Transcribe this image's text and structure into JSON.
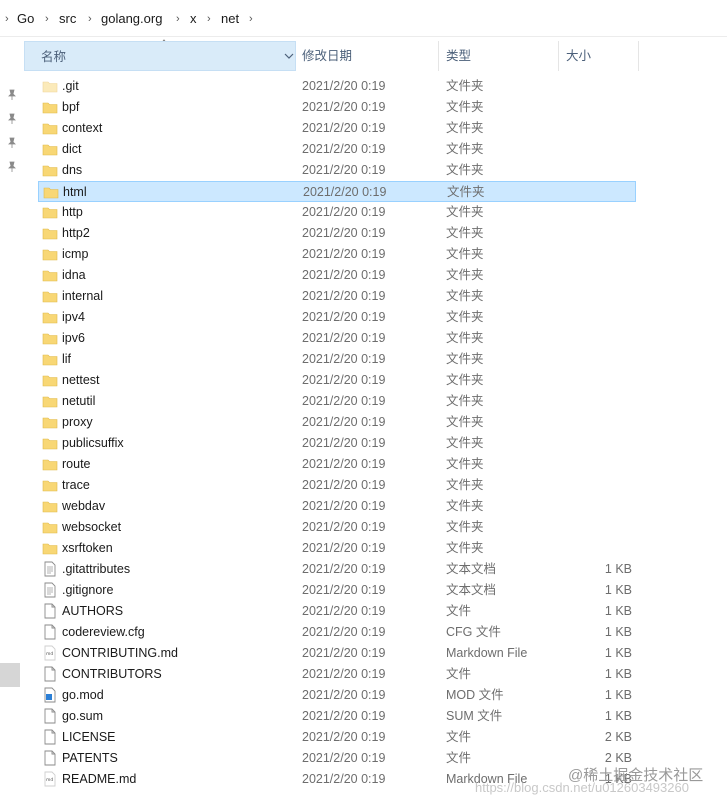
{
  "breadcrumb": [
    "Go",
    "src",
    "golang.org",
    "x",
    "net"
  ],
  "columns": {
    "name": "名称",
    "date": "修改日期",
    "type": "类型",
    "size": "大小"
  },
  "files": [
    {
      "name": ".git",
      "date": "2021/2/20 0:19",
      "type": "文件夹",
      "size": "",
      "icon": "folder-faded-icon"
    },
    {
      "name": "bpf",
      "date": "2021/2/20 0:19",
      "type": "文件夹",
      "size": "",
      "icon": "folder-icon"
    },
    {
      "name": "context",
      "date": "2021/2/20 0:19",
      "type": "文件夹",
      "size": "",
      "icon": "folder-icon"
    },
    {
      "name": "dict",
      "date": "2021/2/20 0:19",
      "type": "文件夹",
      "size": "",
      "icon": "folder-icon"
    },
    {
      "name": "dns",
      "date": "2021/2/20 0:19",
      "type": "文件夹",
      "size": "",
      "icon": "folder-icon"
    },
    {
      "name": "html",
      "date": "2021/2/20 0:19",
      "type": "文件夹",
      "size": "",
      "icon": "folder-icon",
      "selected": true
    },
    {
      "name": "http",
      "date": "2021/2/20 0:19",
      "type": "文件夹",
      "size": "",
      "icon": "folder-icon"
    },
    {
      "name": "http2",
      "date": "2021/2/20 0:19",
      "type": "文件夹",
      "size": "",
      "icon": "folder-icon"
    },
    {
      "name": "icmp",
      "date": "2021/2/20 0:19",
      "type": "文件夹",
      "size": "",
      "icon": "folder-icon"
    },
    {
      "name": "idna",
      "date": "2021/2/20 0:19",
      "type": "文件夹",
      "size": "",
      "icon": "folder-icon"
    },
    {
      "name": "internal",
      "date": "2021/2/20 0:19",
      "type": "文件夹",
      "size": "",
      "icon": "folder-icon"
    },
    {
      "name": "ipv4",
      "date": "2021/2/20 0:19",
      "type": "文件夹",
      "size": "",
      "icon": "folder-icon"
    },
    {
      "name": "ipv6",
      "date": "2021/2/20 0:19",
      "type": "文件夹",
      "size": "",
      "icon": "folder-icon"
    },
    {
      "name": "lif",
      "date": "2021/2/20 0:19",
      "type": "文件夹",
      "size": "",
      "icon": "folder-icon"
    },
    {
      "name": "nettest",
      "date": "2021/2/20 0:19",
      "type": "文件夹",
      "size": "",
      "icon": "folder-icon"
    },
    {
      "name": "netutil",
      "date": "2021/2/20 0:19",
      "type": "文件夹",
      "size": "",
      "icon": "folder-icon"
    },
    {
      "name": "proxy",
      "date": "2021/2/20 0:19",
      "type": "文件夹",
      "size": "",
      "icon": "folder-icon"
    },
    {
      "name": "publicsuffix",
      "date": "2021/2/20 0:19",
      "type": "文件夹",
      "size": "",
      "icon": "folder-icon"
    },
    {
      "name": "route",
      "date": "2021/2/20 0:19",
      "type": "文件夹",
      "size": "",
      "icon": "folder-icon"
    },
    {
      "name": "trace",
      "date": "2021/2/20 0:19",
      "type": "文件夹",
      "size": "",
      "icon": "folder-icon"
    },
    {
      "name": "webdav",
      "date": "2021/2/20 0:19",
      "type": "文件夹",
      "size": "",
      "icon": "folder-icon"
    },
    {
      "name": "websocket",
      "date": "2021/2/20 0:19",
      "type": "文件夹",
      "size": "",
      "icon": "folder-icon"
    },
    {
      "name": "xsrftoken",
      "date": "2021/2/20 0:19",
      "type": "文件夹",
      "size": "",
      "icon": "folder-icon"
    },
    {
      "name": ".gitattributes",
      "date": "2021/2/20 0:19",
      "type": "文本文档",
      "size": "1 KB",
      "icon": "text-document-icon"
    },
    {
      "name": ".gitignore",
      "date": "2021/2/20 0:19",
      "type": "文本文档",
      "size": "1 KB",
      "icon": "text-document-icon"
    },
    {
      "name": "AUTHORS",
      "date": "2021/2/20 0:19",
      "type": "文件",
      "size": "1 KB",
      "icon": "file-icon"
    },
    {
      "name": "codereview.cfg",
      "date": "2021/2/20 0:19",
      "type": "CFG 文件",
      "size": "1 KB",
      "icon": "file-icon"
    },
    {
      "name": "CONTRIBUTING.md",
      "date": "2021/2/20 0:19",
      "type": "Markdown File",
      "size": "1 KB",
      "icon": "markdown-file-icon"
    },
    {
      "name": "CONTRIBUTORS",
      "date": "2021/2/20 0:19",
      "type": "文件",
      "size": "1 KB",
      "icon": "file-icon"
    },
    {
      "name": "go.mod",
      "date": "2021/2/20 0:19",
      "type": "MOD 文件",
      "size": "1 KB",
      "icon": "mod-file-icon"
    },
    {
      "name": "go.sum",
      "date": "2021/2/20 0:19",
      "type": "SUM 文件",
      "size": "1 KB",
      "icon": "file-icon"
    },
    {
      "name": "LICENSE",
      "date": "2021/2/20 0:19",
      "type": "文件",
      "size": "2 KB",
      "icon": "file-icon"
    },
    {
      "name": "PATENTS",
      "date": "2021/2/20 0:19",
      "type": "文件",
      "size": "2 KB",
      "icon": "file-icon"
    },
    {
      "name": "README.md",
      "date": "2021/2/20 0:19",
      "type": "Markdown File",
      "size": "1 KB",
      "icon": "markdown-file-icon"
    }
  ],
  "watermark": {
    "brand": "@稀土掘金技术社区",
    "url": "https://blog.csdn.net/u012603493260"
  },
  "colors": {
    "selected_row": "#cce8ff",
    "selected_border": "#99d1ff",
    "sorted_header": "#d9ebf9",
    "folder": "#f8d775"
  }
}
